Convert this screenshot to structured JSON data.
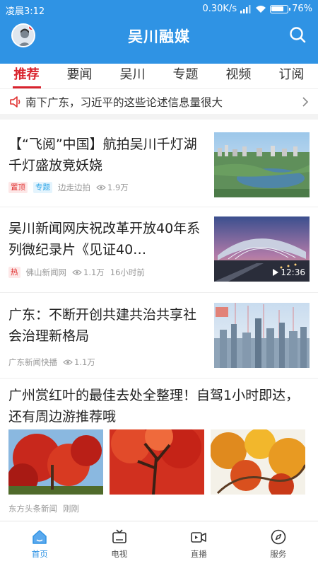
{
  "status_bar": {
    "time": "凌晨3:12",
    "speed": "0.30K/s",
    "battery": "76%"
  },
  "header": {
    "title": "吴川融媒"
  },
  "tabs": [
    {
      "label": "推荐"
    },
    {
      "label": "要闻"
    },
    {
      "label": "吴川"
    },
    {
      "label": "专题"
    },
    {
      "label": "视频"
    },
    {
      "label": "订阅"
    }
  ],
  "ticker": {
    "text": "南下广东，习近平的这些论述信息量很大"
  },
  "news": [
    {
      "title": "【“飞阅”中国】航拍吴川千灯湖 千灯盛放竞妖娆",
      "tags": [
        "置顶",
        "专题"
      ],
      "source": "边走边拍",
      "views": "1.9万"
    },
    {
      "title": "吴川新闻网庆祝改革开放40年系列微纪录片《见证40…",
      "tags": [
        "热"
      ],
      "source": "佛山新闻网",
      "views": "1.1万",
      "time": "16小时前",
      "duration": "12:36"
    },
    {
      "title": "广东：不断开创共建共治共享社会治理新格局",
      "source": "广东新闻快播",
      "views": "1.1万"
    },
    {
      "title": "广州赏红叶的最佳去处全整理！自驾1小时即达，还有周边游推荐哦",
      "source": "东方头条新闻",
      "time": "刚刚"
    }
  ],
  "bottom_nav": [
    {
      "label": "首页",
      "icon": "home-icon"
    },
    {
      "label": "电视",
      "icon": "tv-icon"
    },
    {
      "label": "直播",
      "icon": "live-camera-icon"
    },
    {
      "label": "服务",
      "icon": "compass-icon"
    }
  ],
  "colors": {
    "brand": "#2f93e4",
    "accent": "#d9232d"
  }
}
